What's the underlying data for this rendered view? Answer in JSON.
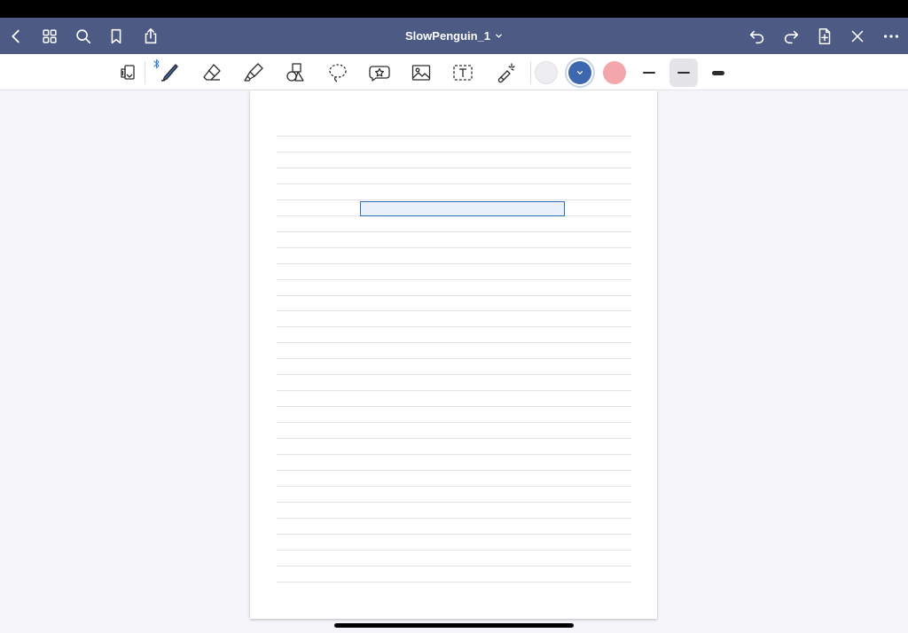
{
  "document": {
    "title": "SlowPenguin_1"
  },
  "colors": {
    "nav_background": "#4c5a84",
    "accent_blue": "#3d68b0",
    "ink_dark": "#2c2c2e",
    "swatch_white": "#eeeef0",
    "swatch_blue": "#3d68b0",
    "swatch_pink": "#f3a6ab",
    "selection_border": "#2f6fb1"
  },
  "nav": {
    "left_icons": [
      "chevron-left-icon",
      "grid-icon",
      "search-icon",
      "bookmark-icon",
      "share-icon"
    ],
    "right_icons": [
      "undo-icon",
      "redo-icon",
      "add-page-icon",
      "close-icon",
      "more-icon"
    ]
  },
  "toolbar": {
    "tools": [
      "read-only-icon",
      "pen-icon",
      "eraser-icon",
      "highlighter-icon",
      "shapes-icon",
      "lasso-icon",
      "elements-icon",
      "image-icon",
      "text-icon",
      "laser-pointer-icon"
    ],
    "selected_tool": "pen",
    "bluetooth_connected": true,
    "colors": [
      "#eeeef0",
      "#3d68b0",
      "#f3a6ab"
    ],
    "selected_color": "#3d68b0",
    "stroke_widths": [
      "thin",
      "medium",
      "thick"
    ],
    "selected_stroke": "medium"
  },
  "page": {
    "paper": "ruled"
  }
}
